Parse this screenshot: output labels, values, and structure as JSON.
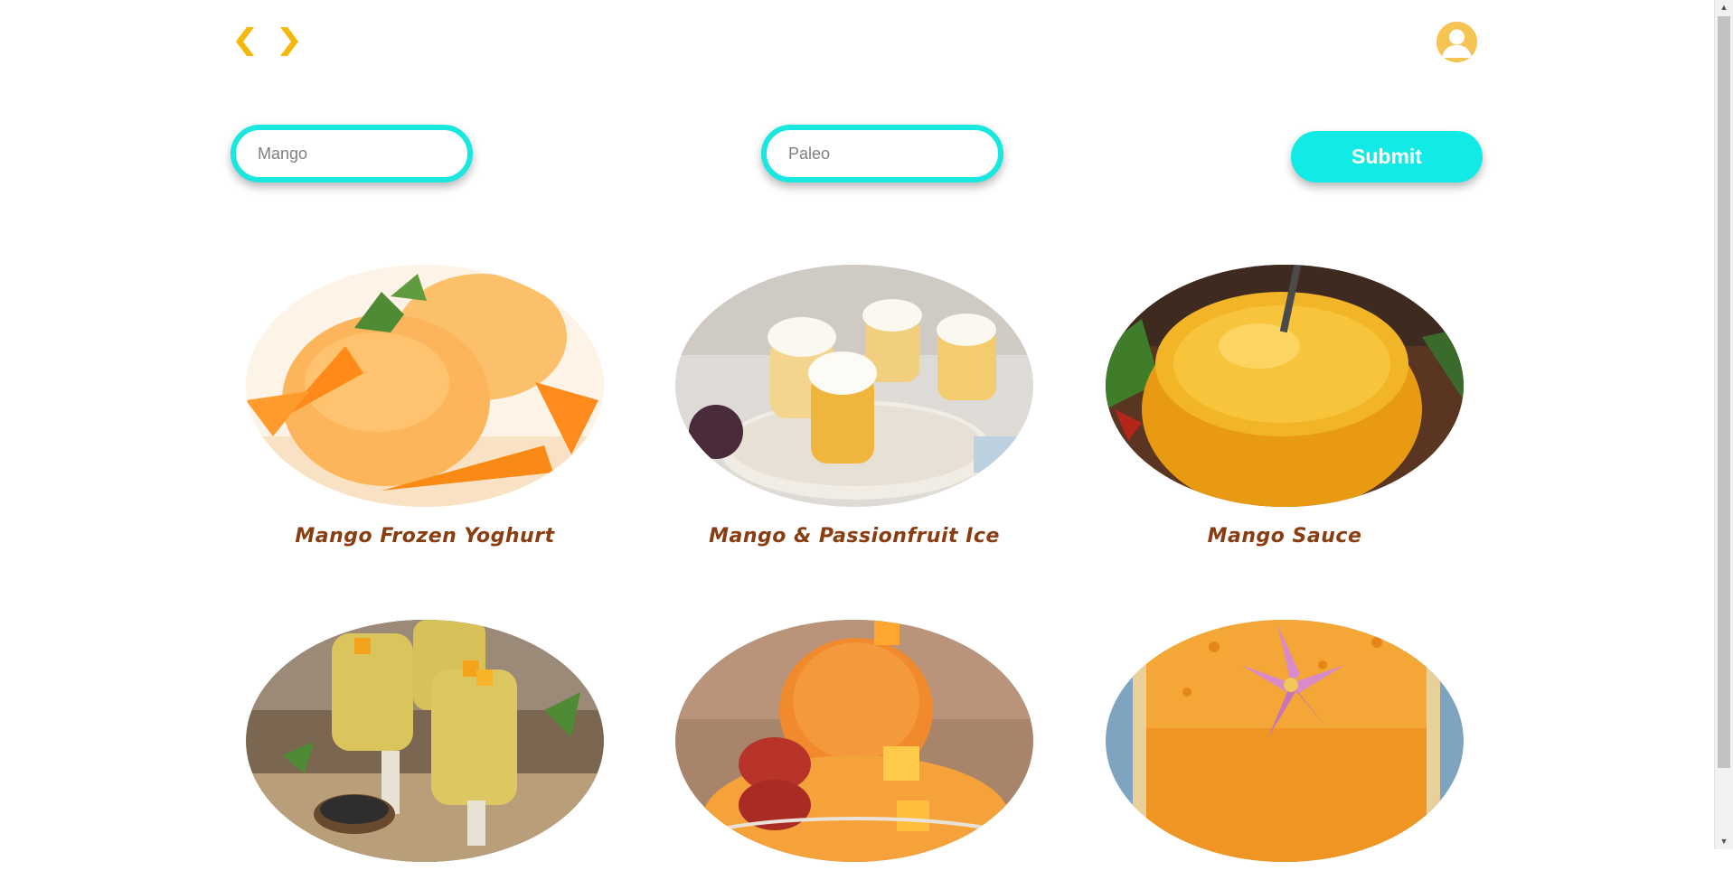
{
  "nav": {
    "back_icon": "chevron-left-icon",
    "forward_icon": "chevron-right-icon",
    "arrow_color": "#f5b70a"
  },
  "user": {
    "avatar_icon": "user-avatar-icon",
    "avatar_color": "#f6c453"
  },
  "search": {
    "ingredient_placeholder": "Mango",
    "diet_placeholder": "Paleo",
    "submit_label": "Submit",
    "accent_color": "#12ebe5"
  },
  "recipes": [
    {
      "title": "Mango Frozen Yoghurt"
    },
    {
      "title": "Mango & Passionfruit Ice"
    },
    {
      "title": "Mango Sauce"
    },
    {
      "title": ""
    },
    {
      "title": ""
    },
    {
      "title": ""
    }
  ],
  "title_color": "#8a3d10"
}
